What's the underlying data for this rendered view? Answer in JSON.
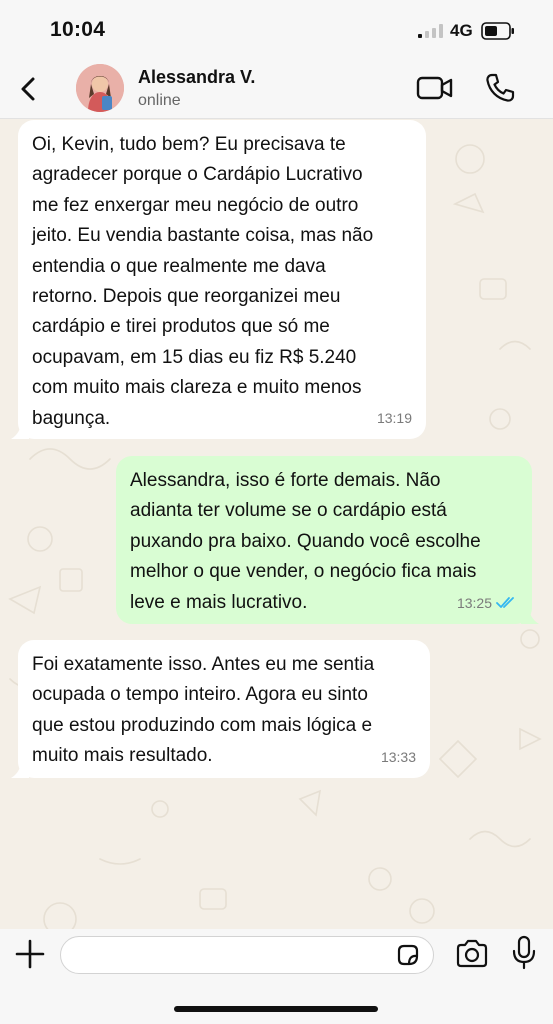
{
  "status_bar": {
    "time": "10:04",
    "network": "4G"
  },
  "header": {
    "contact_name": "Alessandra V.",
    "contact_status": "online"
  },
  "messages": [
    {
      "direction": "incoming",
      "text": "Oi, Kevin, tudo bem? Eu precisava te\nagradecer porque o Cardápio Lucrativo\nme fez enxergar meu negócio de outro\njeito. Eu vendia bastante coisa, mas não\nentendia o que realmente me dava\nretorno. Depois que reorganizei meu\ncardápio e tirei produtos que só me\nocupavam, em 15 dias eu fiz R$ 5.240\ncom muito mais clareza e muito menos\nbagunça.",
      "time": "13:19"
    },
    {
      "direction": "outgoing",
      "text": "Alessandra, isso é forte demais. Não\nadianta ter volume se o cardápio está\npuxando pra baixo. Quando você escolhe\nmelhor o que vender, o negócio fica mais\nleve e mais lucrativo.",
      "time": "13:25",
      "read": true
    },
    {
      "direction": "incoming",
      "text": "Foi exatamente isso. Antes eu me sentia\nocupada o tempo inteiro. Agora eu sinto\nque estou produzindo com mais lógica e\nmuito mais resultado.",
      "time": "13:33"
    }
  ],
  "input": {
    "value": "",
    "placeholder": ""
  },
  "colors": {
    "incoming_bubble": "#ffffff",
    "outgoing_bubble": "#d9fdd3",
    "read_ticks": "#34b7f1",
    "wallpaper": "#f4efe7"
  },
  "icons": [
    "back-icon",
    "video-call-icon",
    "phone-icon",
    "plus-icon",
    "sticker-icon",
    "camera-icon",
    "microphone-icon",
    "read-receipt-icon"
  ]
}
